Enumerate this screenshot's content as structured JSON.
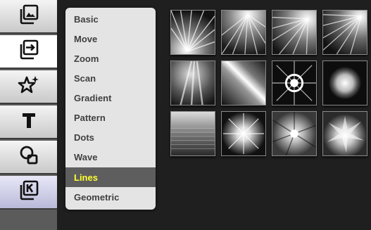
{
  "toolbar": {
    "tools": [
      {
        "name": "image-layers-icon"
      },
      {
        "name": "import-arrow-icon"
      },
      {
        "name": "sparkle-star-icon"
      },
      {
        "name": "text-tool-icon"
      },
      {
        "name": "shapes-icon"
      },
      {
        "name": "k-layers-icon"
      }
    ]
  },
  "menu": {
    "items": [
      "Basic",
      "Move",
      "Zoom",
      "Scan",
      "Gradient",
      "Pattern",
      "Dots",
      "Wave",
      "Lines",
      "Geometric"
    ],
    "selected": "Lines"
  },
  "colors": {
    "background": "#1f1f1f",
    "menu_bg": "#e4e4e4",
    "menu_selected_bg": "#5e5e5e",
    "menu_selected_text": "#ffff33"
  },
  "gallery": {
    "thumbnails": [
      {
        "name": "rays-corner-thumbnail"
      },
      {
        "name": "rays-top-thumbnail"
      },
      {
        "name": "rays-diagonal-thumbnail"
      },
      {
        "name": "rays-topright-thumbnail"
      },
      {
        "name": "light-beams-thumbnail"
      },
      {
        "name": "diagonal-glow-thumbnail"
      },
      {
        "name": "burst-ring-thumbnail"
      },
      {
        "name": "glowing-sphere-thumbnail"
      },
      {
        "name": "horizontal-lines-thumbnail"
      },
      {
        "name": "starburst-thumbnail"
      },
      {
        "name": "radial-spikes-thumbnail"
      },
      {
        "name": "spiky-explosion-thumbnail"
      }
    ]
  }
}
